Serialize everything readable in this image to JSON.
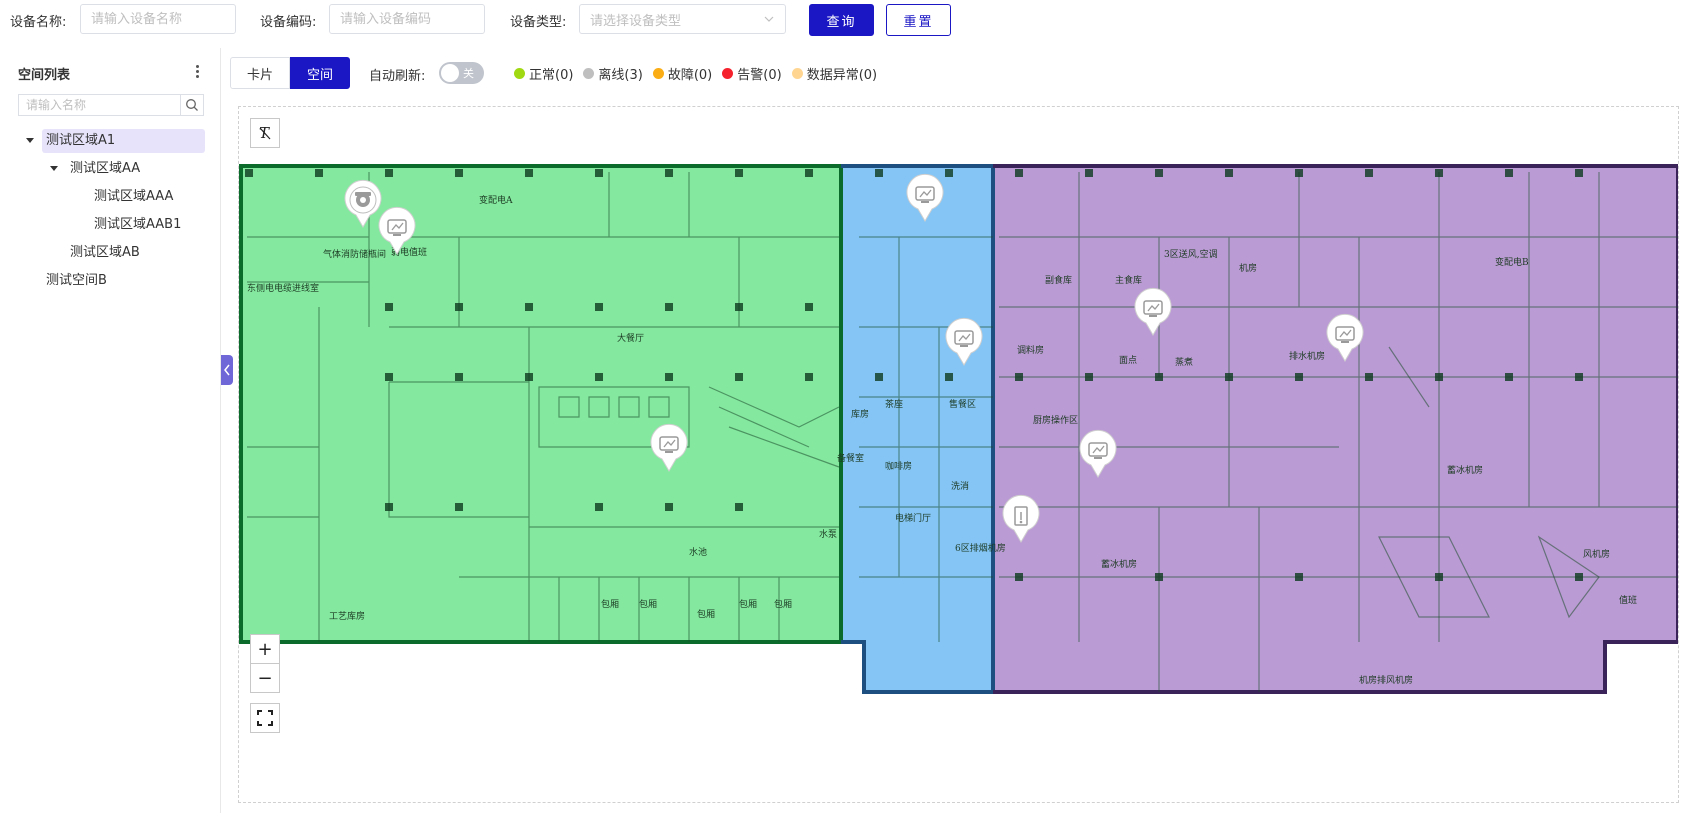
{
  "search": {
    "device_name_label": "设备名称:",
    "device_name_placeholder": "请输入设备名称",
    "device_code_label": "设备编码:",
    "device_code_placeholder": "请输入设备编码",
    "device_type_label": "设备类型:",
    "device_type_placeholder": "请选择设备类型",
    "query_label": "查询",
    "reset_label": "重置"
  },
  "sidebar": {
    "title": "空间列表",
    "search_placeholder": "请输入名称",
    "tree": [
      {
        "label": "测试区域A1",
        "level": 0,
        "expanded": true,
        "selected": true
      },
      {
        "label": "测试区域AA",
        "level": 1,
        "expanded": true
      },
      {
        "label": "测试区域AAA",
        "level": 2
      },
      {
        "label": "测试区域AAB1",
        "level": 2
      },
      {
        "label": "测试区域AB",
        "level": 1
      },
      {
        "label": "测试空间B",
        "level": 0
      }
    ]
  },
  "toolbar": {
    "view_card": "卡片",
    "view_space": "空间",
    "auto_refresh_label": "自动刷新:",
    "auto_refresh_state": "关",
    "legend": [
      {
        "label": "正常(0)",
        "color": "#a0d911"
      },
      {
        "label": "离线(3)",
        "color": "#bfbfbf"
      },
      {
        "label": "故障(0)",
        "color": "#faad14"
      },
      {
        "label": "告警(0)",
        "color": "#f5222d"
      },
      {
        "label": "数据异常(0)",
        "color": "#ffd591"
      }
    ]
  },
  "map": {
    "zones": [
      {
        "name": "zone-a",
        "color": "#55e07a"
      },
      {
        "name": "zone-b",
        "color": "#4aaaf0"
      },
      {
        "name": "zone-c",
        "color": "#9b6cc0"
      }
    ],
    "floor_labels": [
      "变配电A",
      "气体消防储瓶间",
      "弱电值班",
      "东侧电电缆进线室",
      "大餐厅",
      "水池",
      "工艺库房",
      "包厢",
      "包厢",
      "包厢",
      "包厢",
      "包厢",
      "库房",
      "茶座",
      "备餐室",
      "咖啡房",
      "水泵",
      "电梯门厅",
      "副食库",
      "主食库",
      "3区送风,空调",
      "机房",
      "变配电B",
      "调料房",
      "面点",
      "蒸煮",
      "售餐区",
      "厨房操作区",
      "洗消",
      "6区排烟机房",
      "蓄冰机房",
      "蓄冰机房",
      "风机房",
      "机房排风机房",
      "排水机房",
      "值班"
    ],
    "devices": [
      {
        "type": "camera",
        "status": "offline"
      },
      {
        "type": "sensor",
        "status": "offline"
      },
      {
        "type": "sensor",
        "status": "offline"
      },
      {
        "type": "sensor",
        "status": "offline"
      },
      {
        "type": "sensor",
        "status": "offline"
      },
      {
        "type": "sensor",
        "status": "offline"
      },
      {
        "type": "sensor",
        "status": "offline"
      },
      {
        "type": "sensor",
        "status": "offline"
      },
      {
        "type": "meter",
        "status": "offline"
      }
    ],
    "tools": {
      "zoom_in": "+",
      "zoom_out": "−"
    }
  }
}
